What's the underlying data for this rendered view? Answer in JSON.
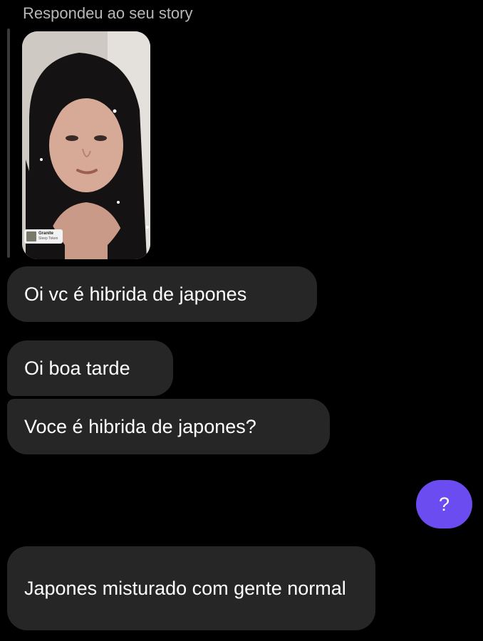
{
  "reply": {
    "caption": "Respondeu ao seu story"
  },
  "story": {
    "music_sticker": {
      "song": "Granite",
      "artist": "Sleep Token"
    }
  },
  "messages": [
    {
      "side": "received",
      "text": "Oi vc é hibrida de japones"
    },
    {
      "side": "received",
      "text": "Oi boa tarde"
    },
    {
      "side": "received",
      "text": "Voce é hibrida de japones?"
    },
    {
      "side": "sent",
      "text": "?"
    },
    {
      "side": "received",
      "text": "Japones misturado com gente normal"
    }
  ],
  "colors": {
    "background": "#000000",
    "received_bubble": "#262626",
    "sent_bubble": "#6a4cf0",
    "caption_text": "#b8b8b8"
  }
}
